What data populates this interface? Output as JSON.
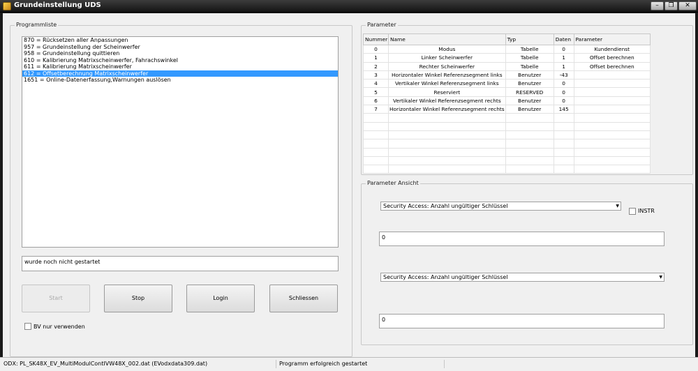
{
  "window": {
    "title": "Grundeinstellung UDS"
  },
  "program_list": {
    "group_label": "Programmliste",
    "items": [
      "870 = Rücksetzen aller Anpassungen",
      "957 = Grundeinstellung der Scheinwerfer",
      "958 = Grundeinstellung quittieren",
      "610 = Kalibrierung Matrixscheinwerfer, Fahrachswinkel",
      "611 = Kalibrierung Matrixscheinwerfer",
      "612 = Offsetberechnung Matrixscheinwerfer",
      "1651 = Online-Datenerfassung,Warnungen auslösen"
    ],
    "selected_index": 5,
    "status_text": "wurde noch nicht gestartet"
  },
  "buttons": {
    "start": "Start",
    "stop": "Stop",
    "login": "Login",
    "close": "Schliessen"
  },
  "bv_checkbox": {
    "label": "BV nur verwenden",
    "checked": false
  },
  "parameter": {
    "group_label": "Parameter",
    "headers": [
      "Nummer",
      "Name",
      "Typ",
      "Daten",
      "Parameter"
    ],
    "rows": [
      [
        "0",
        "Modus",
        "Tabelle",
        "0",
        "Kundendienst"
      ],
      [
        "1",
        "Linker Scheinwerfer",
        "Tabelle",
        "1",
        "Offset berechnen"
      ],
      [
        "2",
        "Rechter Scheinwerfer",
        "Tabelle",
        "1",
        "Offset berechnen"
      ],
      [
        "3",
        "Horizontaler Winkel Referenzsegment links",
        "Benutzer",
        "-43",
        ""
      ],
      [
        "4",
        "Vertikaler Winkel Referenzsegment links",
        "Benutzer",
        "0",
        ""
      ],
      [
        "5",
        "Reserviert",
        "RESERVED",
        "0",
        ""
      ],
      [
        "6",
        "Vertikaler Winkel Referenzsegment rechts",
        "Benutzer",
        "0",
        ""
      ],
      [
        "7",
        "Horizontaler Winkel Referenzsegment rechts",
        "Benutzer",
        "145",
        ""
      ]
    ]
  },
  "parameter_view": {
    "group_label": "Parameter Ansicht",
    "combo1": "Security Access: Anzahl ungültiger Schlüssel",
    "instr_label": "INSTR",
    "value1": "0",
    "combo2": "Security Access: Anzahl ungültiger Schlüssel",
    "value2": "0"
  },
  "status_bar": {
    "odx": "ODX: PL_SK48X_EV_MultiModulContIVW48X_002.dat (EVodxdata309.dat)",
    "message": "Programm erfolgreich gestartet"
  }
}
